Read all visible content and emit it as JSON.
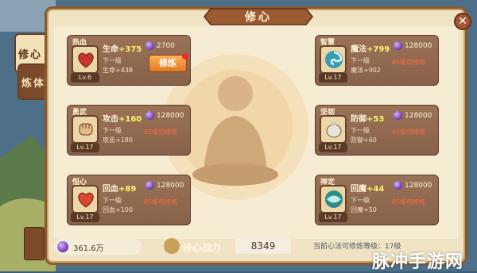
{
  "window": {
    "title": "修心"
  },
  "tabs": [
    {
      "label": "修心",
      "active": true
    },
    {
      "label": "炼体",
      "active": false
    }
  ],
  "cards": [
    {
      "name": "热血",
      "stat_label": "生命",
      "stat_value": "+375",
      "next_label": "下一级",
      "next_value": "生命+438",
      "cost": "2700",
      "level": "Lv.6",
      "action": "修炼",
      "icon": "heart-icon"
    },
    {
      "name": "智慧",
      "stat_label": "魔法",
      "stat_value": "+799",
      "next_label": "下一级",
      "next_value": "魔法+902",
      "cost": "128000",
      "level": "Lv.17",
      "status": "85级可修炼",
      "icon": "swirl-icon"
    },
    {
      "name": "勇武",
      "stat_label": "攻击",
      "stat_value": "+160",
      "next_label": "下一级",
      "next_value": "攻击+180",
      "cost": "128000",
      "level": "Lv.17",
      "status": "85级可修炼",
      "icon": "fist-icon"
    },
    {
      "name": "坚韧",
      "stat_label": "防御",
      "stat_value": "+53",
      "next_label": "下一级",
      "next_value": "防御+60",
      "cost": "128000",
      "level": "Lv.17",
      "status": "85级可修炼",
      "icon": "kettle-icon"
    },
    {
      "name": "恒心",
      "stat_label": "回血",
      "stat_value": "+89",
      "next_label": "下一级",
      "next_value": "回血+100",
      "cost": "128000",
      "level": "Lv.17",
      "status": "85级可修炼",
      "icon": "heart-icon"
    },
    {
      "name": "禅定",
      "stat_label": "回魔",
      "stat_value": "+44",
      "next_label": "下一级",
      "next_value": "回魔+50",
      "cost": "128000",
      "level": "Lv.17",
      "status": "85级可修炼",
      "icon": "swirl-icon"
    }
  ],
  "bottom": {
    "currency_value": "361.6万",
    "power_label": "修心战力",
    "power_value": "8349",
    "method_level": "当前心法可修炼等级：17级"
  },
  "watermark": "脉冲手游网",
  "colors": {
    "frame": "#8a5a34",
    "panel": "#efe3c4",
    "card": "#8f674d",
    "accent_orange": "#f09035",
    "locked_text": "#ff6b46",
    "stat_value": "#fff36e"
  }
}
